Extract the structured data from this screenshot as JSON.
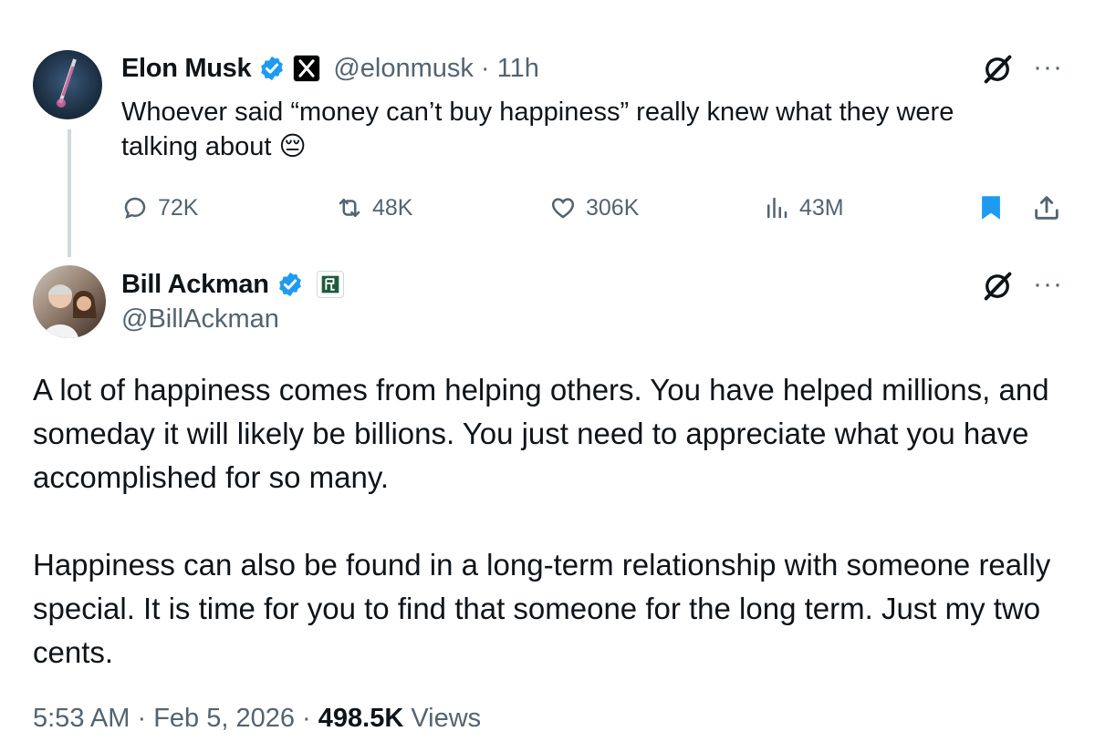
{
  "tweet1": {
    "author_name": "Elon Musk",
    "author_handle": "@elonmusk",
    "time": "· 11h",
    "text": "Whoever said “money can’t buy happiness” really knew what they were talking about 😔",
    "stats": {
      "replies": "72K",
      "reposts": "48K",
      "likes": "306K",
      "views": "43M"
    }
  },
  "tweet2": {
    "author_name": "Bill Ackman",
    "author_handle": "@BillAckman",
    "paragraphs": [
      "A lot of happiness comes from helping others. You have helped millions, and someday it will likely be billions. You just need to appreciate what you have accomplished for so many.",
      "Happiness can also be found in a long-term relationship with someone really special. It is time for you to find that someone for the long term. Just my two cents."
    ],
    "footer": {
      "time": "5:53 AM",
      "date": "Feb 5, 2026",
      "views_count": "498.5K",
      "views_label": "Views"
    }
  },
  "colors": {
    "verified": "#1d9bf0",
    "bookmark": "#1d9bf0",
    "text": "#0f1419",
    "secondary": "#536471",
    "thread_line": "#cfd9de"
  },
  "icons": [
    "verified-badge-icon",
    "x-affiliate-icon",
    "grok-icon",
    "more-icon",
    "reply-icon",
    "repost-icon",
    "like-icon",
    "views-icon",
    "bookmark-icon",
    "share-icon",
    "pershing-affiliate-icon"
  ]
}
